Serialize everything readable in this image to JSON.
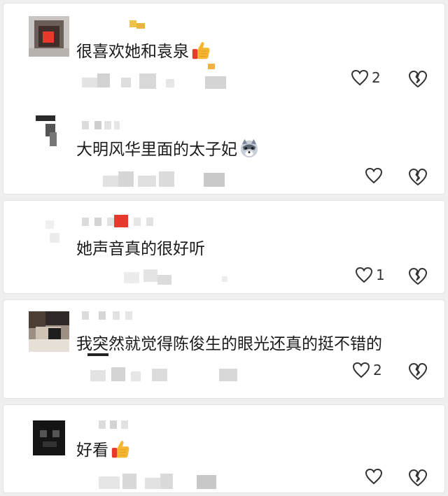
{
  "comments": [
    {
      "text": "很喜欢她和袁泉",
      "emoji": "thumbs-up-emoji",
      "likes": "2"
    },
    {
      "text": "大明风华里面的太子妃",
      "emoji": "wolf-face-emoji",
      "likes": ""
    },
    {
      "text": "她声音真的很好听",
      "emoji": "",
      "likes": "1"
    },
    {
      "text": "我突然就觉得陈俊生的眼光还真的挺不错的",
      "emoji": "",
      "likes": "2"
    },
    {
      "text": "好看",
      "emoji": "thumbs-up-emoji",
      "likes": ""
    }
  ],
  "icons": {
    "like": "heart-outline-icon",
    "dislike": "broken-heart-icon"
  },
  "colors": {
    "background": "#efefef",
    "card": "#ffffff",
    "text": "#1b1b1b",
    "icon": "#333333",
    "thumb": "#f5b631",
    "accent_red": "#e8392c"
  }
}
